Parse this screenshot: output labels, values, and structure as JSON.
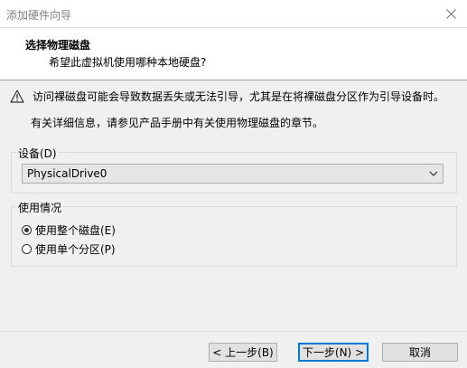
{
  "window": {
    "title": "添加硬件向导",
    "close_icon": "close-icon"
  },
  "header": {
    "title": "选择物理磁盘",
    "subtitle": "希望此虚拟机使用哪种本地硬盘?"
  },
  "warning": {
    "icon": "warning-icon",
    "text": "访问裸磁盘可能会导致数据丢失或无法引导，尤其是在将裸磁盘分区作为引导设备时。"
  },
  "info": {
    "text": "有关详细信息，请参见产品手册中有关使用物理磁盘的章节。"
  },
  "device": {
    "label": "设备(D)",
    "selected": "PhysicalDrive0",
    "arrow_icon": "chevron-down-icon"
  },
  "usage": {
    "label": "使用情况",
    "options": [
      {
        "label": "使用整个磁盘(E)",
        "checked": true
      },
      {
        "label": "使用单个分区(P)",
        "checked": false
      }
    ]
  },
  "footer": {
    "back_label": "< 上一步(B)",
    "next_label": "下一步(N) >",
    "cancel_label": "取消"
  }
}
